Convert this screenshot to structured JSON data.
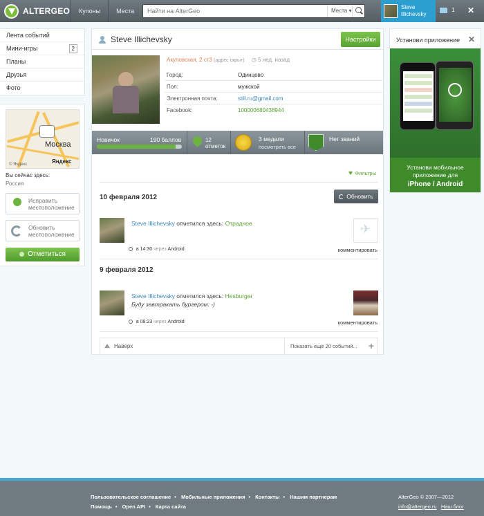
{
  "topbar": {
    "logo_text": "ALTERGEO",
    "nav": [
      "Купоны",
      "Места"
    ],
    "search_placeholder": "Найти на AlterGeo",
    "search_scope": "Места ▾",
    "user_name_line1": "Steve",
    "user_name_line2": "Illichevsky",
    "messages_count": "1",
    "close": "✕"
  },
  "sidebar": {
    "items": [
      {
        "label": "Лента событий"
      },
      {
        "label": "Мини-игры",
        "badge": "2"
      },
      {
        "label": "Планы"
      },
      {
        "label": "Друзья"
      },
      {
        "label": "Фото"
      }
    ]
  },
  "location": {
    "map_city": "Москва",
    "map_brand": "Яндекс",
    "map_link": "© Яндекс",
    "here_label": "Вы сейчас здесь:",
    "here_value": "Россия",
    "fix_label_1": "Исправить",
    "fix_label_2": "местоположение",
    "update_label_1": "Обновить",
    "update_label_2": "местоположение",
    "checkin_label": "Отметиться"
  },
  "profile": {
    "name": "Steve Illichevsky",
    "settings_label": "Настройки",
    "address": "Акуловская, 2 ст3",
    "address_note": "(адрес скрыт)",
    "last_seen": "5 нед. назад",
    "info": [
      {
        "key": "Город:",
        "value": "Одинцово",
        "style": ""
      },
      {
        "key": "Пол:",
        "value": "мужской",
        "style": ""
      },
      {
        "key": "Электронная почта:",
        "value": "still.ru@gmail.com",
        "style": "link"
      },
      {
        "key": "Facebook:",
        "value": "100000680438944",
        "style": "green"
      }
    ]
  },
  "stats": {
    "level": "Новичок",
    "points": "190 баллов",
    "level_progress": 0.93,
    "checkins_count": "12",
    "checkins_label": "отметок",
    "medals": "3 медали",
    "medals_link": "посмотреть все",
    "ranks": "Нет званий"
  },
  "feed": {
    "filters_label": "Фильтры",
    "refresh_label": "Обновить",
    "comment_label": "комментировать",
    "checked_in_text": "отметился здесь:",
    "days": [
      {
        "date": "10 февраля 2012",
        "user": "Steve Illichevsky",
        "place": "Отрадное",
        "quote": "",
        "time": "в 14:30",
        "via": "через",
        "client": "Android"
      },
      {
        "date": "9 февраля 2012",
        "user": "Steve Illichevsky",
        "place": "Hesburger",
        "quote": "Буду завтракать бургером: -)",
        "time": "в 08:23",
        "via": "через",
        "client": "Android"
      }
    ],
    "up_label": "Наверх",
    "more_label": "Показать ещё 20 событий..."
  },
  "ad": {
    "title": "Установи приложение",
    "line1": "Установи мобильное",
    "line2": "приложение для",
    "platforms": "iPhone / Android"
  },
  "footer": {
    "links_row1": [
      "Пользовательское соглашение",
      "Мобильные приложения",
      "Контакты",
      "Нашим партнерам"
    ],
    "links_row2": [
      "Помощь",
      "Open API",
      "Карта сайта"
    ],
    "copyright": "AlterGeo © 2007—2012",
    "email": "info@altergeo.ru",
    "blog": "Наш блог"
  },
  "colors": {
    "accent_green": "#6db33f",
    "accent_blue": "#2c9fd0",
    "topbar": "#5f696e"
  }
}
